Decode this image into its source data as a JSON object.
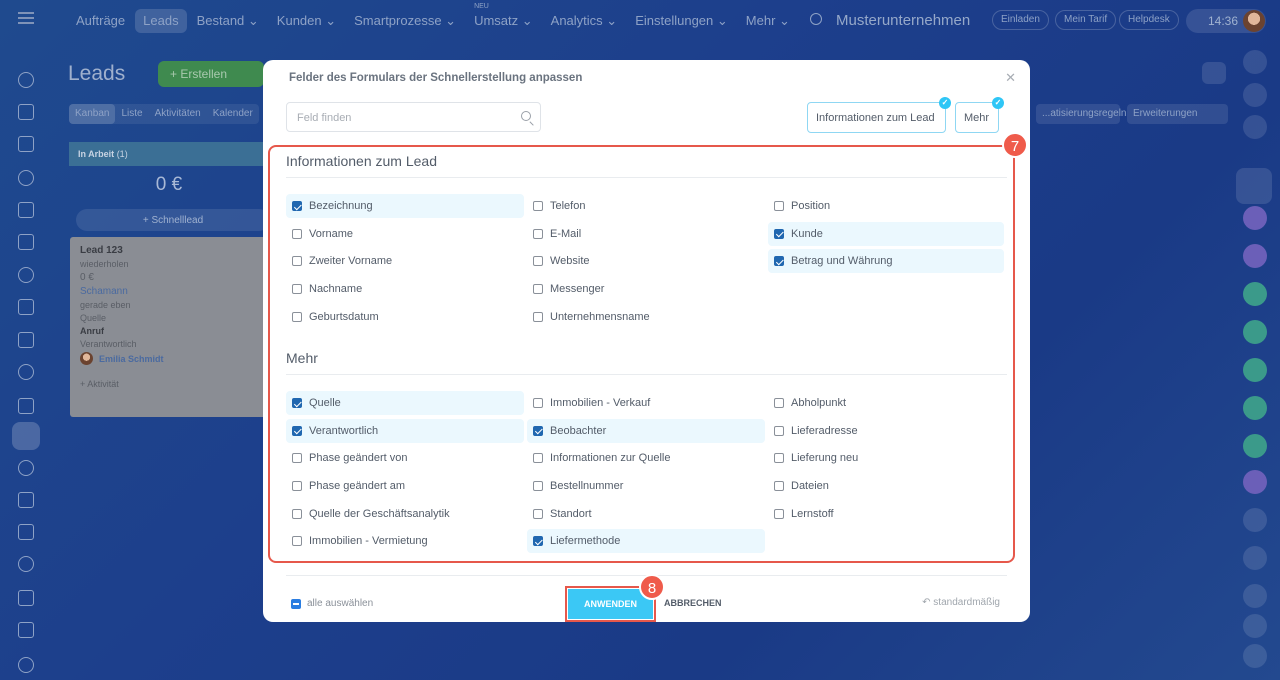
{
  "topbar": {
    "nav": [
      "Aufträge",
      "Leads",
      "Bestand",
      "Kunden",
      "Smartprozesse",
      "Umsatz",
      "Analytics",
      "Einstellungen",
      "Mehr"
    ],
    "new_badge": "NEU",
    "company": "Musterunternehmen",
    "invite": "Einladen",
    "tariff": "Mein Tarif",
    "helpdesk": "Helpdesk",
    "time": "14:36"
  },
  "page": {
    "title": "Leads",
    "create": "+ Erstellen",
    "tabs": [
      "Kanban",
      "Liste",
      "Aktivitäten",
      "Kalender"
    ],
    "automation": "...atisierungsregeln",
    "extensions": "Erweiterungen"
  },
  "kanban": {
    "column": "In Arbeit",
    "count": "(1)",
    "sum": "0 €",
    "quick": "+ Schnelllead",
    "card": {
      "title": "Lead 123",
      "sub": "wiederholen",
      "amount": "0 €",
      "client": "Schamann",
      "time": "gerade eben",
      "source_label": "Quelle",
      "source": "Anruf",
      "resp_label": "Verantwortlich",
      "resp": "Emilia Schmidt",
      "activity": "+ Aktivität"
    }
  },
  "modal": {
    "title": "Felder des Formulars der Schnellerstellung anpassen",
    "search_placeholder": "Feld finden",
    "chips": [
      "Informationen zum Lead",
      "Mehr"
    ],
    "sections": [
      {
        "title": "Informationen zum Lead",
        "items": [
          [
            "Bezeichnung",
            true
          ],
          [
            "Telefon",
            false
          ],
          [
            "Position",
            false
          ],
          [
            "Vorname",
            false
          ],
          [
            "E-Mail",
            false
          ],
          [
            "Kunde",
            true
          ],
          [
            "Zweiter Vorname",
            false
          ],
          [
            "Website",
            false
          ],
          [
            "Betrag und Währung",
            true
          ],
          [
            "Nachname",
            false
          ],
          [
            "Messenger",
            false
          ],
          null,
          [
            "Geburtsdatum",
            false
          ],
          [
            "Unternehmensname",
            false
          ],
          null
        ]
      },
      {
        "title": "Mehr",
        "items": [
          [
            "Quelle",
            true
          ],
          [
            "Immobilien - Verkauf",
            false
          ],
          [
            "Abholpunkt",
            false
          ],
          [
            "Verantwortlich",
            true
          ],
          [
            "Beobachter",
            true
          ],
          [
            "Lieferadresse",
            false
          ],
          [
            "Phase geändert von",
            false
          ],
          [
            "Informationen zur Quelle",
            false
          ],
          [
            "Lieferung neu",
            false
          ],
          [
            "Phase geändert am",
            false
          ],
          [
            "Bestellnummer",
            false
          ],
          [
            "Dateien",
            false
          ],
          [
            "Quelle der Geschäftsanalytik",
            false
          ],
          [
            "Standort",
            false
          ],
          [
            "Lernstoff",
            false
          ],
          [
            "Immobilien - Vermietung",
            false
          ],
          [
            "Liefermethode",
            true
          ],
          null
        ]
      }
    ],
    "select_all": "alle auswählen",
    "apply": "ANWENDEN",
    "cancel": "ABBRECHEN",
    "default": "standardmäßig"
  },
  "annotations": {
    "step1": "7",
    "step2": "8"
  }
}
